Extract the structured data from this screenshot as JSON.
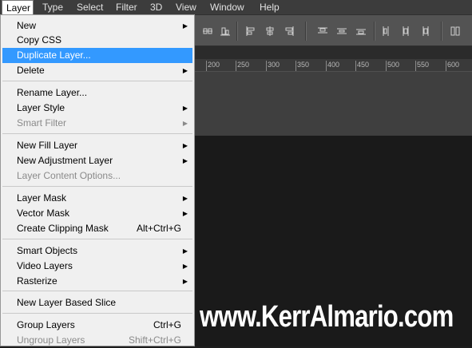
{
  "menubar": {
    "items": [
      {
        "label": "Layer"
      },
      {
        "label": "Type"
      },
      {
        "label": "Select"
      },
      {
        "label": "Filter"
      },
      {
        "label": "3D"
      },
      {
        "label": "View"
      },
      {
        "label": "Window"
      },
      {
        "label": "Help"
      }
    ]
  },
  "layer_menu": {
    "items": [
      {
        "label": "New",
        "submenu": true
      },
      {
        "label": "Copy CSS"
      },
      {
        "label": "Duplicate Layer...",
        "highlighted": true
      },
      {
        "label": "Delete",
        "submenu": true
      },
      {
        "label": "Rename Layer..."
      },
      {
        "label": "Layer Style",
        "submenu": true
      },
      {
        "label": "Smart Filter",
        "submenu": true,
        "disabled": true
      },
      {
        "label": "New Fill Layer",
        "submenu": true
      },
      {
        "label": "New Adjustment Layer",
        "submenu": true
      },
      {
        "label": "Layer Content Options...",
        "disabled": true
      },
      {
        "label": "Layer Mask",
        "submenu": true
      },
      {
        "label": "Vector Mask",
        "submenu": true
      },
      {
        "label": "Create Clipping Mask",
        "shortcut": "Alt+Ctrl+G"
      },
      {
        "label": "Smart Objects",
        "submenu": true
      },
      {
        "label": "Video Layers",
        "submenu": true
      },
      {
        "label": "Rasterize",
        "submenu": true
      },
      {
        "label": "New Layer Based Slice"
      },
      {
        "label": "Group Layers",
        "shortcut": "Ctrl+G"
      },
      {
        "label": "Ungroup Layers",
        "shortcut": "Shift+Ctrl+G",
        "disabled": true
      }
    ]
  },
  "ruler": {
    "labels": [
      "200",
      "250",
      "300",
      "350",
      "400",
      "450",
      "500",
      "550",
      "600"
    ]
  },
  "watermark": {
    "text": "www.KerrAlmario.com"
  },
  "colors": {
    "highlight": "#3399ff",
    "menu_bg": "#f0f0f0",
    "menubar_bg": "#3c3c3c"
  }
}
